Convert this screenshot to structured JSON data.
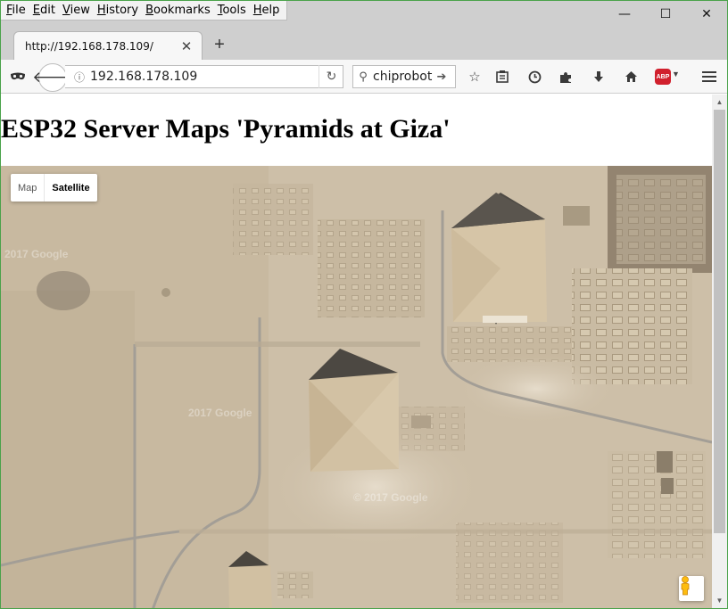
{
  "menubar": {
    "items": [
      {
        "accel": "F",
        "rest": "ile"
      },
      {
        "accel": "E",
        "rest": "dit"
      },
      {
        "accel": "V",
        "rest": "iew"
      },
      {
        "accel": "H",
        "rest": "istory"
      },
      {
        "accel": "B",
        "rest": "ookmarks"
      },
      {
        "accel": "T",
        "rest": "ools"
      },
      {
        "accel": "H",
        "rest": "elp"
      }
    ]
  },
  "window_controls": {
    "minimize": "—",
    "maximize": "☐",
    "close": "✕"
  },
  "tabs": [
    {
      "title": "http://192.168.178.109/",
      "close": "✕"
    }
  ],
  "new_tab": "+",
  "navbar": {
    "url": "192.168.178.109",
    "search_value": "chiprobot",
    "abp_label": "ABP"
  },
  "page": {
    "heading": "ESP32 Server Maps 'Pyramids at Giza'"
  },
  "map": {
    "map_type_map": "Map",
    "map_type_satellite": "Satellite",
    "selected_type": "Satellite",
    "watermarks": [
      "2017 Google",
      "2017 Google",
      "© 2017 Google"
    ]
  },
  "colors": {
    "desert": "#cdbfa8",
    "pyramid_light": "#d9c9ac",
    "pyramid_shadow": "#5b564e",
    "road": "#a39e96"
  }
}
